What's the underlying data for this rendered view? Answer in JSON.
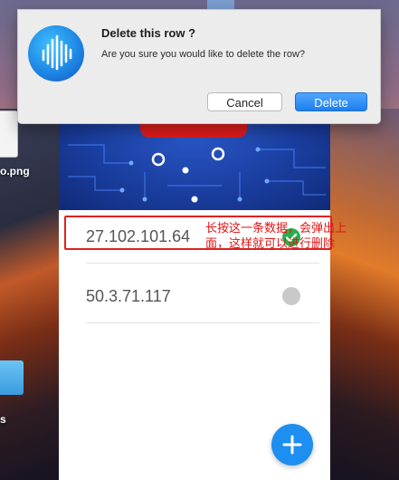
{
  "dialog": {
    "title": "Delete this row ?",
    "message": "Are you sure you would like to delete the row?",
    "cancel_label": "Cancel",
    "delete_label": "Delete"
  },
  "desktop": {
    "file_label": "o.png",
    "folder_label": "s"
  },
  "list": {
    "rows": [
      {
        "ip": "27.102.101.64",
        "status": "selected"
      },
      {
        "ip": "50.3.71.117",
        "status": "inactive"
      }
    ]
  },
  "annotation": {
    "text": "长按这一条数据，会弹出上面，这样就可以进行删除"
  },
  "fab": {
    "label": "+"
  },
  "colors": {
    "accent": "#1e8ef0",
    "delete_button": "#1f7fef",
    "annotation_red": "#e02020",
    "status_green": "#26b14c",
    "status_gray": "#c9c9c9",
    "header_blue": "#1a3ea0"
  },
  "icons": {
    "app": "sound-waves-icon",
    "check": "checkmark-icon",
    "add": "plus-icon"
  }
}
